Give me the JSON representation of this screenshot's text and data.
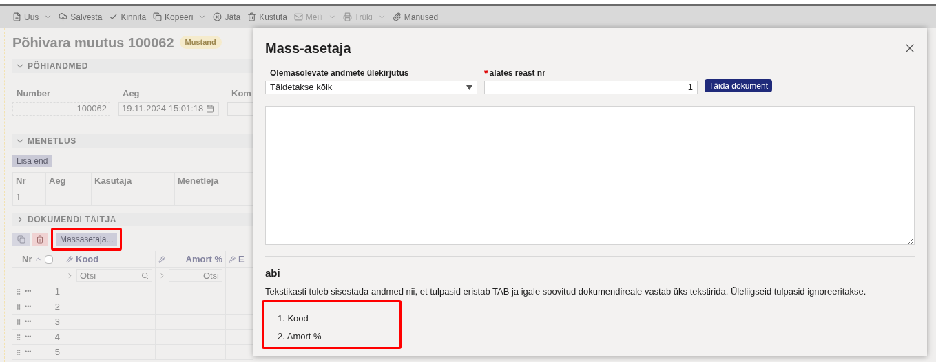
{
  "toolbar": [
    {
      "label": "Uus",
      "kind": "dropdown",
      "disabled": false
    },
    {
      "label": "Salvesta",
      "kind": "save",
      "disabled": false
    },
    {
      "label": "Kinnita",
      "kind": "confirm",
      "disabled": false
    },
    {
      "label": "Kopeeri",
      "kind": "copy-dropdown",
      "disabled": false
    },
    {
      "label": "Jäta",
      "kind": "cancel",
      "disabled": false
    },
    {
      "label": "Kustuta",
      "kind": "delete",
      "disabled": false
    },
    {
      "label": "Meili",
      "kind": "mail-dropdown",
      "disabled": true
    },
    {
      "label": "Trüki",
      "kind": "print-dropdown",
      "disabled": true
    },
    {
      "label": "Manused",
      "kind": "attach",
      "disabled": false
    }
  ],
  "document": {
    "title": "Põhivara muutus 100062",
    "status": "Mustand",
    "main_section": {
      "title": "PÕHIANDMED",
      "expanded": true,
      "fields": [
        {
          "label": "Number",
          "value": "100062",
          "kind": "number"
        },
        {
          "label": "Aeg",
          "value": "19.11.2024 15:01:18",
          "kind": "date"
        },
        {
          "label": "Kom",
          "kind": "text"
        }
      ]
    },
    "procedure_section": {
      "title": "MENETLUS",
      "expanded": true,
      "button": "Lisa end",
      "columns": [
        "Nr",
        "Aeg",
        "Kasutaja",
        "Menetleja"
      ],
      "rows": [
        [
          "1"
        ]
      ]
    },
    "filler_section": {
      "title": "DOKUMENDI TÄITJA",
      "expanded": false,
      "button": "Massasetaja...",
      "columns": [
        {
          "label": "Nr",
          "kind": "nr",
          "checked": false
        },
        {
          "label": "Kood",
          "kind": "text"
        },
        {
          "label": "Amort %",
          "kind": "number"
        },
        {
          "label": "E",
          "kind": "text"
        }
      ],
      "filters": [
        "Otsi",
        "Otsi"
      ],
      "rows": [
        "1",
        "2",
        "3",
        "4",
        "5"
      ],
      "row_menu": "•••"
    }
  },
  "dialog": {
    "title": "Mass-asetaja",
    "overwrite": {
      "label": "Olemasolevate andmete ülekirjutus",
      "value": "Täidetakse kõik"
    },
    "start_row": {
      "label": "alates reast nr",
      "required": true,
      "required_mark": "*",
      "value": "1"
    },
    "fill_button": "Täida dokument",
    "help": {
      "title": "abi",
      "text": "Tekstikasti tuleb sisestada andmed nii, et tulpasid eristab TAB ja igale soovitud dokumendireale vastab üks tekstirida. Üleliigseid tulpasid ignoreeritakse.",
      "items": [
        "1. Kood",
        "2. Amort %"
      ]
    }
  }
}
